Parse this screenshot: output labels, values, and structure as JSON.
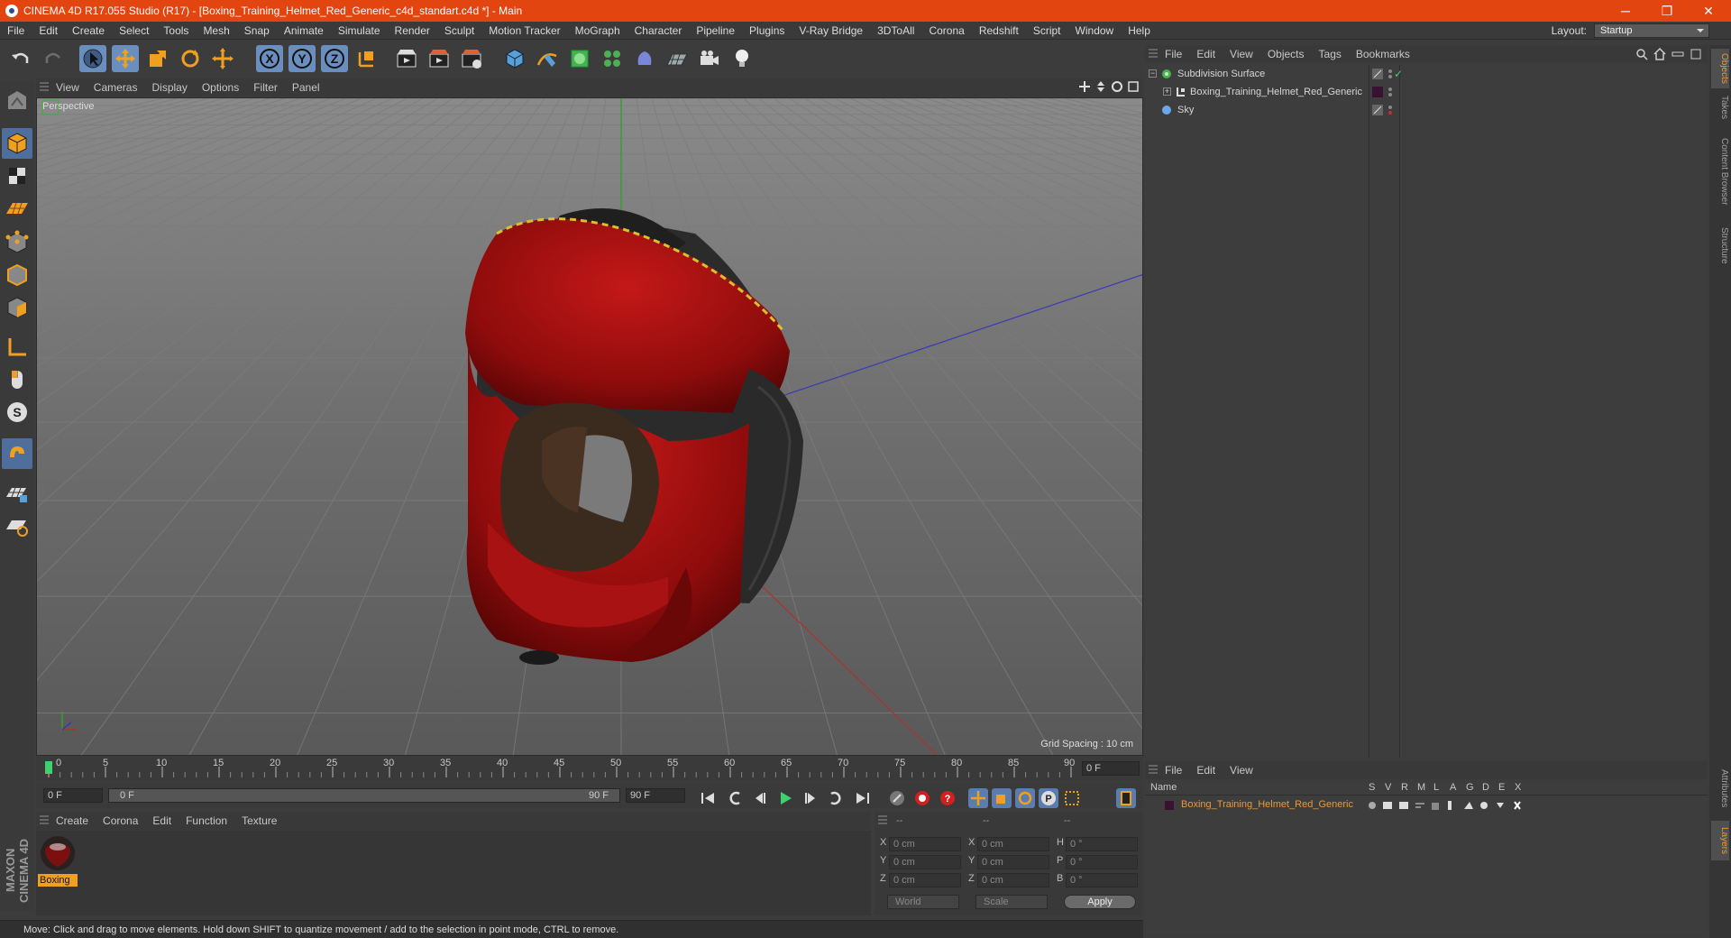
{
  "window": {
    "title": "CINEMA 4D R17.055 Studio (R17) - [Boxing_Training_Helmet_Red_Generic_c4d_standart.c4d *] - Main",
    "min": "─",
    "max": "❐",
    "close": "✕"
  },
  "menu": [
    "File",
    "Edit",
    "Create",
    "Select",
    "Tools",
    "Mesh",
    "Snap",
    "Animate",
    "Simulate",
    "Render",
    "Sculpt",
    "Motion Tracker",
    "MoGraph",
    "Character",
    "Pipeline",
    "Plugins",
    "V-Ray Bridge",
    "3DToAll",
    "Corona",
    "Redshift",
    "Script",
    "Window",
    "Help"
  ],
  "layout": {
    "label": "Layout:",
    "value": "Startup"
  },
  "viewport": {
    "menu": [
      "View",
      "Cameras",
      "Display",
      "Options",
      "Filter",
      "Panel"
    ],
    "label": "Perspective",
    "grid_spacing": "Grid Spacing : 10 cm"
  },
  "timeline": {
    "ticks": [
      "0",
      "5",
      "10",
      "15",
      "20",
      "25",
      "30",
      "35",
      "40",
      "45",
      "50",
      "55",
      "60",
      "65",
      "70",
      "75",
      "80",
      "85",
      "90"
    ],
    "current_frame": "0 F",
    "start": "0 F",
    "range_start": "0 F",
    "range_end": "90 F",
    "end": "90 F"
  },
  "material_panel": {
    "menu": [
      "Create",
      "Corona",
      "Edit",
      "Function",
      "Texture"
    ],
    "material_name": "Boxing"
  },
  "coordinates": {
    "header": [
      "--",
      "--",
      "--"
    ],
    "rows": [
      {
        "a": "X",
        "av": "0 cm",
        "b": "X",
        "bv": "0 cm",
        "c": "H",
        "cv": "0 °"
      },
      {
        "a": "Y",
        "av": "0 cm",
        "b": "Y",
        "bv": "0 cm",
        "c": "P",
        "cv": "0 °"
      },
      {
        "a": "Z",
        "av": "0 cm",
        "b": "Z",
        "bv": "0 cm",
        "c": "B",
        "cv": "0 °"
      }
    ],
    "mode": "World",
    "scale": "Scale",
    "apply": "Apply"
  },
  "status": "Move: Click and drag to move elements. Hold down SHIFT to quantize movement / add to the selection in point mode, CTRL to remove.",
  "object_manager": {
    "menu": [
      "File",
      "Edit",
      "View",
      "Objects",
      "Tags",
      "Bookmarks"
    ],
    "objects": [
      {
        "name": "Subdivision Surface"
      },
      {
        "name": "Boxing_Training_Helmet_Red_Generic"
      },
      {
        "name": "Sky"
      }
    ]
  },
  "layer_manager": {
    "menu": [
      "File",
      "Edit",
      "View"
    ],
    "columns": [
      "Name",
      "S",
      "V",
      "R",
      "M",
      "L",
      "A",
      "G",
      "D",
      "E",
      "X"
    ],
    "layer": "Boxing_Training_Helmet_Red_Generic"
  },
  "right_tabs": [
    "Objects",
    "Takes",
    "Content Browser",
    "Structure",
    "Attributes",
    "Layers"
  ],
  "brand": "MAXON CINEMA 4D",
  "colors": {
    "title_bar": "#e2450f",
    "accent": "#e89a3c",
    "selection_blue": "#6a8fbf",
    "helmet_red": "#b01010"
  }
}
